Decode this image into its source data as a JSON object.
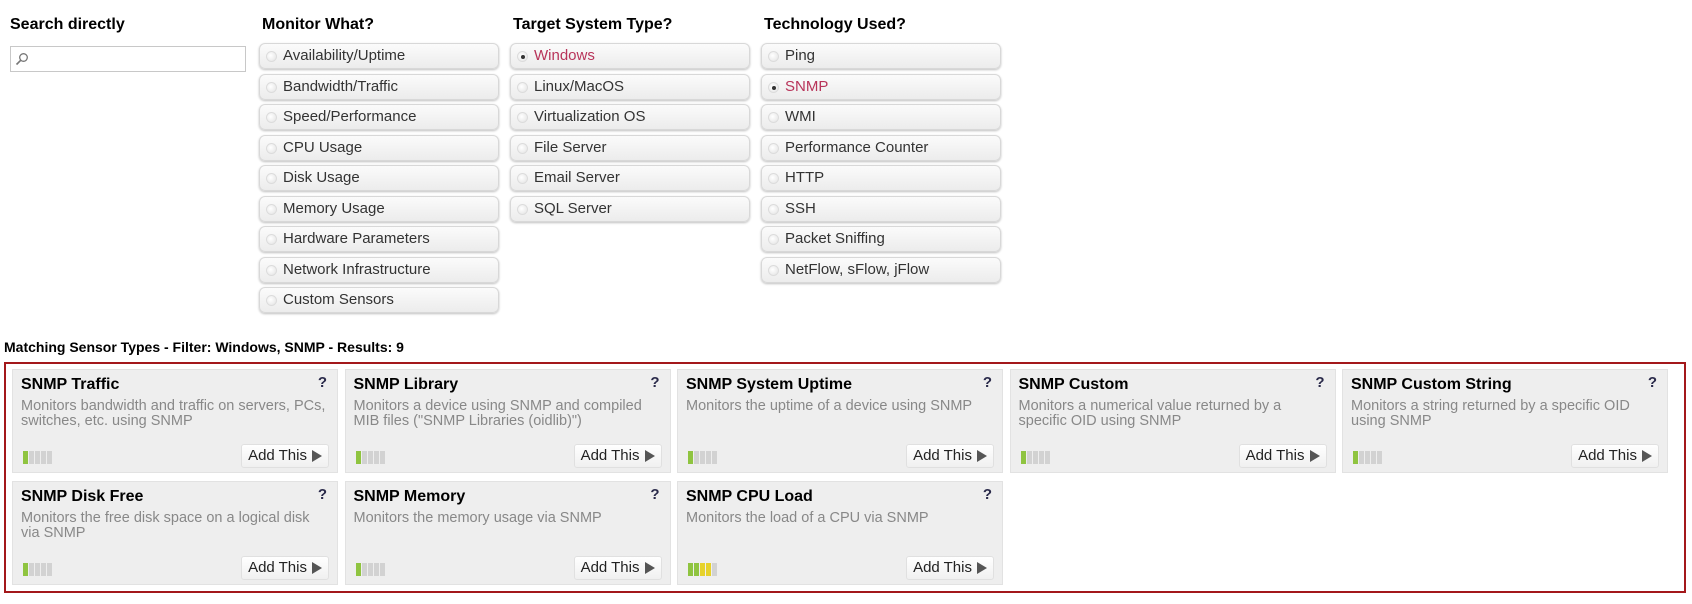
{
  "search": {
    "title": "Search directly",
    "value": "",
    "placeholder": "",
    "icon": "search-icon"
  },
  "monitor_what": {
    "title": "Monitor What?",
    "options": [
      {
        "label": "Availability/Uptime",
        "selected": false
      },
      {
        "label": "Bandwidth/Traffic",
        "selected": false
      },
      {
        "label": "Speed/Performance",
        "selected": false
      },
      {
        "label": "CPU Usage",
        "selected": false
      },
      {
        "label": "Disk Usage",
        "selected": false
      },
      {
        "label": "Memory Usage",
        "selected": false
      },
      {
        "label": "Hardware Parameters",
        "selected": false
      },
      {
        "label": "Network Infrastructure",
        "selected": false
      },
      {
        "label": "Custom Sensors",
        "selected": false
      }
    ]
  },
  "target_system": {
    "title": "Target System Type?",
    "options": [
      {
        "label": "Windows",
        "selected": true
      },
      {
        "label": "Linux/MacOS",
        "selected": false
      },
      {
        "label": "Virtualization OS",
        "selected": false
      },
      {
        "label": "File Server",
        "selected": false
      },
      {
        "label": "Email Server",
        "selected": false
      },
      {
        "label": "SQL Server",
        "selected": false
      }
    ]
  },
  "technology": {
    "title": "Technology Used?",
    "options": [
      {
        "label": "Ping",
        "selected": false
      },
      {
        "label": "SNMP",
        "selected": true
      },
      {
        "label": "WMI",
        "selected": false
      },
      {
        "label": "Performance Counter",
        "selected": false
      },
      {
        "label": "HTTP",
        "selected": false
      },
      {
        "label": "SSH",
        "selected": false
      },
      {
        "label": "Packet Sniffing",
        "selected": false
      },
      {
        "label": "NetFlow, sFlow, jFlow",
        "selected": false
      }
    ]
  },
  "results": {
    "label": "Matching Sensor Types - Filter: Windows, SNMP - Results: 9",
    "add_label": "Add This",
    "help_label": "?",
    "colors": {
      "border": "#a3181b",
      "selected": "#b8345a",
      "meter_green": "#8fc440",
      "meter_yellow": "#e6d22b"
    },
    "cards": [
      {
        "title": "SNMP Traffic",
        "desc": "Monitors bandwidth and traffic on servers, PCs, switches, etc. using SNMP",
        "meter": [
          "green",
          "gray",
          "gray",
          "gray",
          "gray"
        ]
      },
      {
        "title": "SNMP Library",
        "desc": "Monitors a device using SNMP and compiled MIB files (\"SNMP Libraries (oidlib)\")",
        "meter": [
          "green",
          "gray",
          "gray",
          "gray",
          "gray"
        ]
      },
      {
        "title": "SNMP System Uptime",
        "desc": "Monitors the uptime of a device using SNMP",
        "meter": [
          "green",
          "gray",
          "gray",
          "gray",
          "gray"
        ]
      },
      {
        "title": "SNMP Custom",
        "desc": "Monitors a numerical value returned by a specific OID using SNMP",
        "meter": [
          "green",
          "gray",
          "gray",
          "gray",
          "gray"
        ]
      },
      {
        "title": "SNMP Custom String",
        "desc": "Monitors a string returned by a specific OID using SNMP",
        "meter": [
          "green",
          "gray",
          "gray",
          "gray",
          "gray"
        ]
      },
      {
        "title": "SNMP Disk Free",
        "desc": "Monitors the free disk space on a logical disk via SNMP",
        "meter": [
          "green",
          "gray",
          "gray",
          "gray",
          "gray"
        ]
      },
      {
        "title": "SNMP Memory",
        "desc": "Monitors the memory usage via SNMP",
        "meter": [
          "green",
          "gray",
          "gray",
          "gray",
          "gray"
        ]
      },
      {
        "title": "SNMP CPU Load",
        "desc": "Monitors the load of a CPU via SNMP",
        "meter": [
          "green",
          "green",
          "yellow",
          "yellow",
          "gray"
        ]
      }
    ]
  }
}
